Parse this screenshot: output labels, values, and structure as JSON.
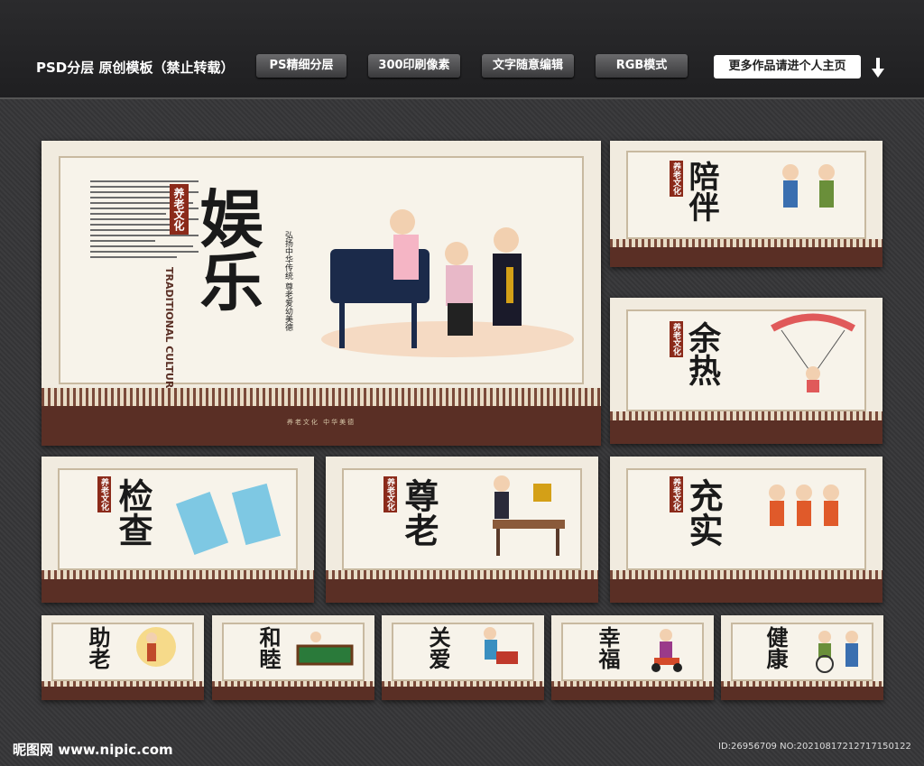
{
  "header": {
    "title": "PSD分层 原创模板（禁止转载）",
    "badges": [
      "PS精细分层",
      "300印刷像素",
      "文字随意编辑",
      "RGB模式"
    ],
    "more_button": "更多作品请进个人主页"
  },
  "main_panel": {
    "title": "娱乐",
    "seal": "养老文化",
    "english": "TRADITIONAL CULTURE",
    "subtitle": "弘扬中华传统 尊老爱幼美德",
    "footer": "养老文化 中华美德"
  },
  "panels": [
    {
      "title": "陪伴",
      "seal": "养老文化"
    },
    {
      "title": "余热",
      "seal": "养老文化"
    },
    {
      "title": "检查",
      "seal": "养老文化"
    },
    {
      "title": "尊老",
      "seal": "养老文化"
    },
    {
      "title": "充实",
      "seal": "养老文化"
    },
    {
      "title": "助老",
      "seal": ""
    },
    {
      "title": "和睦",
      "seal": ""
    },
    {
      "title": "关爱",
      "seal": ""
    },
    {
      "title": "幸福",
      "seal": ""
    },
    {
      "title": "健康",
      "seal": ""
    }
  ],
  "footer": {
    "site": "昵图网 www.nipic.com",
    "id": "ID:26956709 NO:20210817212717150122"
  },
  "colors": {
    "footer_brown": "#5a2f25",
    "seal_red": "#8b2a1a",
    "bg": "#3a3a3c"
  }
}
